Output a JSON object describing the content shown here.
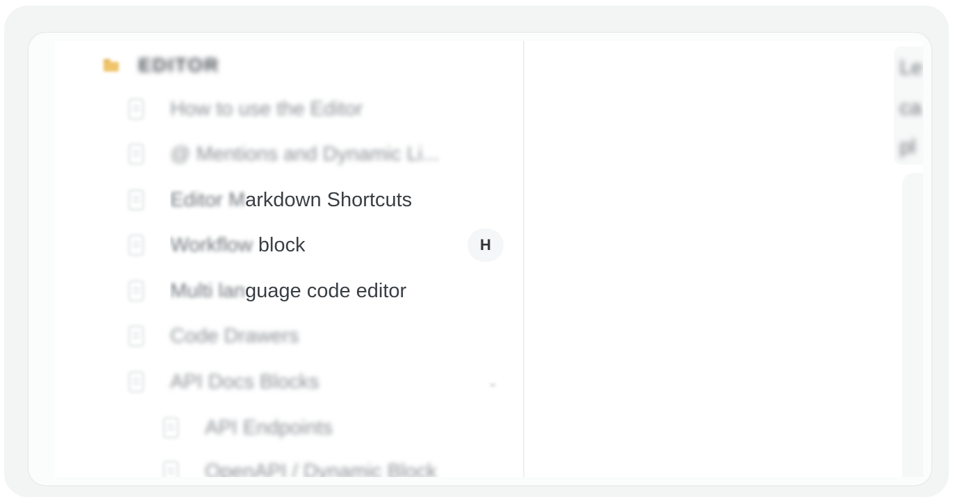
{
  "sidebar": {
    "section": {
      "icon": "folder-icon",
      "title": "EDITOR"
    },
    "items": [
      {
        "icon": "page-icon",
        "label": "How to use the Editor"
      },
      {
        "icon": "page-icon",
        "label": "@ Mentions and Dynamic Li..."
      },
      {
        "icon": "page-icon",
        "label_blurred": "Editor M",
        "label_clear": "arkdown Shortcuts"
      },
      {
        "icon": "page-icon",
        "label_blurred": "Workflow",
        "label_clear": " block",
        "badge": "H"
      },
      {
        "icon": "page-icon",
        "label_blurred": "Multi lan",
        "label_clear": "guage code editor"
      },
      {
        "icon": "page-icon",
        "label": "Code Drawers"
      },
      {
        "icon": "page-icon",
        "label": "API Docs Blocks",
        "expandable": true
      },
      {
        "icon": "page-icon",
        "label": "API Endpoints",
        "nested": true
      },
      {
        "icon": "page-icon",
        "label": "OpenAPI / Dynamic Block",
        "nested": true
      }
    ]
  },
  "content": {
    "toc_fragments": [
      "Le",
      "ca",
      "pl"
    ]
  },
  "colors": {
    "frame": "#f3f5f5",
    "text": "#33383d",
    "badge_bg": "#f5f6f7",
    "folder": "#efc46a"
  }
}
